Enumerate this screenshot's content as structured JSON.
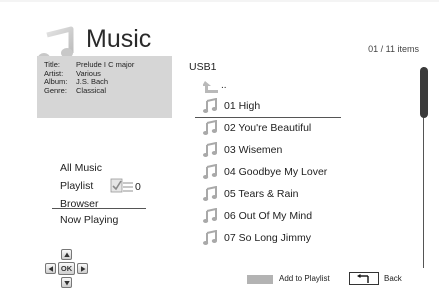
{
  "header": {
    "title": "Music",
    "count": "01 / 11 items"
  },
  "info": {
    "rows": [
      {
        "key": "Title:",
        "value": "Prelude I C major"
      },
      {
        "key": "Artist:",
        "value": "Various"
      },
      {
        "key": "Album:",
        "value": "J.S. Bach"
      },
      {
        "key": "Genre:",
        "value": "Classical"
      }
    ]
  },
  "menu": {
    "all_music": "All Music",
    "playlist": "Playlist",
    "playlist_count": "0",
    "browser": "Browser",
    "now_playing": "Now Playing"
  },
  "browser": {
    "folder": "USB1",
    "parent": "..",
    "tracks": [
      "01 High",
      "02 You're Beautiful",
      "03 Wisemen",
      "04 Goodbye My Lover",
      "05 Tears & Rain",
      "06 Out Of My Mind",
      "07 So Long Jimmy"
    ],
    "selected_index": 0,
    "scroll_position": "1/11"
  },
  "navpad": {
    "ok_label": "OK"
  },
  "footer": {
    "add_label": "Add to Playlist",
    "back_label": "Back"
  },
  "colors": {
    "panel": "#d6d6d6",
    "swatch": "#b3b3b3",
    "scroll_thumb": "#3b3b3b"
  },
  "icons": [
    "music-note-icon",
    "folder-up-icon",
    "playlist-icon",
    "arrow-up-icon",
    "arrow-left-icon",
    "arrow-right-icon",
    "arrow-down-icon",
    "return-arrow-icon"
  ]
}
